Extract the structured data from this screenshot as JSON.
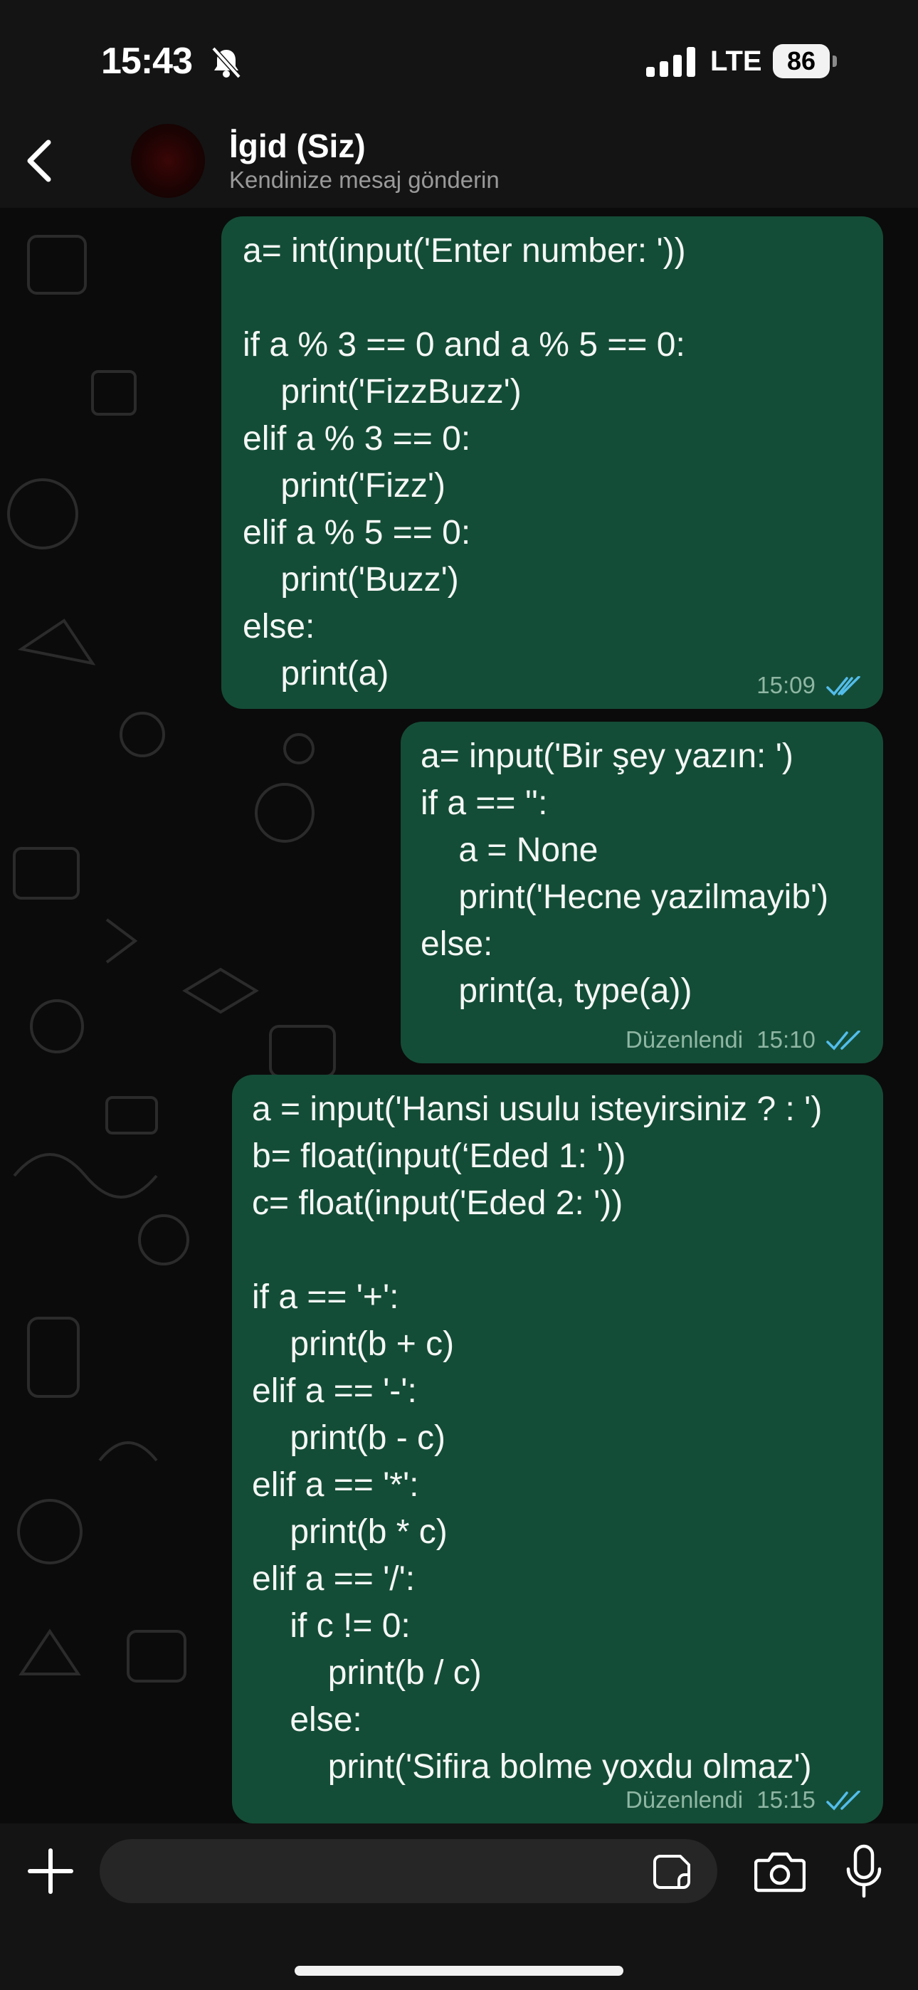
{
  "status_bar": {
    "time": "15:43",
    "network": "LTE",
    "battery": "86"
  },
  "chat_header": {
    "name": "İgid (Siz)",
    "subtitle": "Kendinize mesaj gönderin"
  },
  "messages": [
    {
      "text": "a= int(input('Enter number: '))\n\nif a % 3 == 0 and a % 5 == 0:\n    print('FizzBuzz')\nelif a % 3 == 0:\n    print('Fizz')\nelif a % 5 == 0:\n    print('Buzz')\nelse:\n    print(a)",
      "time": "15:09",
      "edited": ""
    },
    {
      "text": "a= input('Bir şey yazın: ')\nif a == '':\n    a = None\n    print('Hecne yazilmayib')\nelse:\n    print(a, type(a))",
      "time": "15:10",
      "edited": "Düzenlendi"
    },
    {
      "text": "a = input('Hansi usulu isteyirsiniz ? : ')\nb= float(input(‘Eded 1: '))\nc= float(input('Eded 2: '))\n\nif a == '+':\n    print(b + c)\nelif a == '-':\n    print(b - c)\nelif a == '*':\n    print(b * c)\nelif a == '/':\n    if c != 0:\n        print(b / c)\n    else:\n        print('Sifira bolme yoxdu olmaz')",
      "time": "15:15",
      "edited": "Düzenlendi"
    }
  ],
  "icons": {
    "status": [
      "bell-slash-icon",
      "signal-icon",
      "battery-icon"
    ],
    "header": [
      "back-chevron-icon"
    ],
    "input_bar": [
      "plus-icon",
      "sticker-icon",
      "camera-icon",
      "mic-icon"
    ],
    "read_receipt": "double-check-icon"
  },
  "colors": {
    "background": "#0b0b0b",
    "bar": "#141414",
    "outgoing_bubble": "#144d37",
    "read_tick": "#53bdeb"
  }
}
